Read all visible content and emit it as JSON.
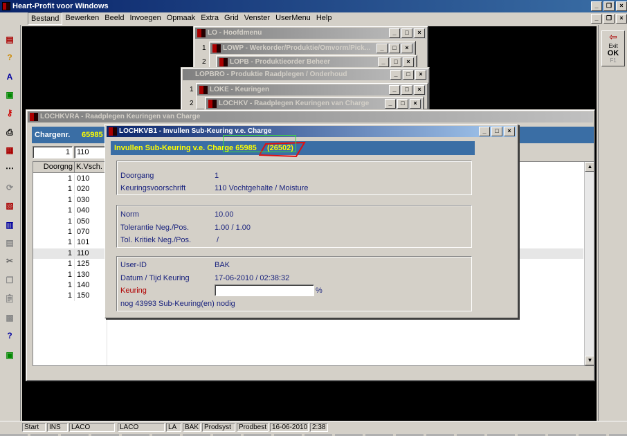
{
  "app": {
    "title": "Heart-Profit voor Windows"
  },
  "menu": [
    "Bestand",
    "Bewerken",
    "Beeld",
    "Invoegen",
    "Opmaak",
    "Extra",
    "Grid",
    "Venster",
    "UserMenu",
    "Help"
  ],
  "right_toolbar": {
    "exit_label": "Exit",
    "ok_label": "OK",
    "ok_sub": "F1"
  },
  "windows": {
    "lo": {
      "title": "LO - Hoofdmenu"
    },
    "lowp": {
      "num": "1",
      "title": "LOWP - Werkorder/Produktie/Omvorm/Pick..."
    },
    "lopb": {
      "num": "2",
      "title": "LOPB - Produktieorder Beheer"
    },
    "lopbro": {
      "title": "LOPBRO - Produktie Raadplegen / Onderhoud"
    },
    "loke": {
      "num": "1",
      "title": "LOKE - Keuringen"
    },
    "lochkv": {
      "num": "2",
      "title": "LOCHKV - Raadplegen Keuringen van Charge"
    },
    "lochkvra": {
      "title": "LOCHKVRA - Raadplegen Keuringen van Charge"
    }
  },
  "lochkvra": {
    "charge_label": "Chargenr.",
    "charge_value": "65985",
    "input1": "1",
    "input2": "110",
    "columns": [
      "Doorgng",
      "K.Vsch."
    ],
    "rows": [
      [
        "1",
        "010"
      ],
      [
        "1",
        "020"
      ],
      [
        "1",
        "030"
      ],
      [
        "1",
        "040"
      ],
      [
        "1",
        "050"
      ],
      [
        "1",
        "070"
      ],
      [
        "1",
        "101"
      ],
      [
        "1",
        "110"
      ],
      [
        "1",
        "125"
      ],
      [
        "1",
        "130"
      ],
      [
        "1",
        "140"
      ],
      [
        "1",
        "150"
      ]
    ]
  },
  "dialog": {
    "title": "LOCHKVB1 - Invullen Sub-Keuring v.e. Charge",
    "header_text": "Invullen Sub-Keuring v.e. Charge 65985",
    "header_code": "(26502)",
    "doorgang_label": "Doorgang",
    "doorgang_value": "1",
    "voorschrift_label": "Keuringsvoorschrift",
    "voorschrift_value": "110 Vochtgehalte / Moisture",
    "norm_label": "Norm",
    "norm_value": "10.00",
    "tolerantie_label": "Tolerantie   Neg./Pos.",
    "tolerantie_value": "1.00 / 1.00",
    "kritiek_label": "Tol. Kritiek Neg./Pos.",
    "kritiek_value": "/",
    "userid_label": "User-ID",
    "userid_value": "BAK",
    "datum_label": "Datum / Tijd Keuring",
    "datum_value": "17-06-2010 / 02:38:32",
    "keuring_label": "Keuring",
    "keuring_value": "",
    "percent": "%",
    "nodig_text": "nog 43993 Sub-Keuring(en) nodig"
  },
  "status": [
    "Start",
    "INS",
    "LACO",
    "LACO",
    "LA",
    "BAK",
    "Prodsyst",
    "Prodbest",
    "16-06-2010",
    "2:38"
  ]
}
